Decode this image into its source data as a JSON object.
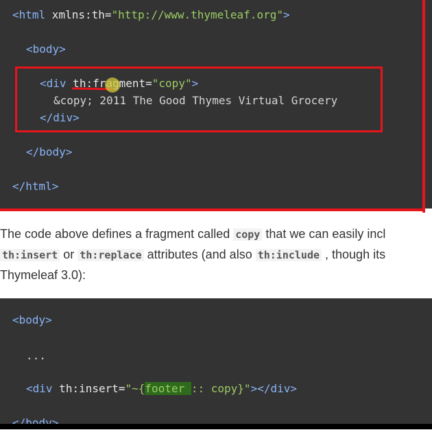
{
  "code_block_1": {
    "lines": [
      {
        "open": "<",
        "tag": "html",
        "attr": " xmlns:th",
        "eq": "=",
        "str": "\"http://www.thymeleaf.org\"",
        "close": ">"
      },
      {
        "text": "<body>"
      },
      {
        "open": "<",
        "tag": "div",
        "attr": " th:fragment",
        "eq": "=",
        "str": "\"copy\"",
        "close": ">"
      },
      {
        "text": "&copy; 2011 The Good Thymes Virtual Grocery"
      },
      {
        "text": "</div>"
      },
      {
        "text": "</body>"
      },
      {
        "text": "</html>"
      }
    ]
  },
  "paragraph": {
    "line1_pre": "The code above defines a fragment called ",
    "line1_code": "copy",
    "line1_post": " that we can easily incl",
    "line2_code1": "th:insert",
    "line2_mid1": " or ",
    "line2_code2": "th:replace",
    "line2_mid2": " attributes (and also ",
    "line2_code3": "th:include",
    "line2_post": " , though its",
    "line3": "Thymeleaf 3.0):"
  },
  "code_block_2": {
    "body_open": "<body>",
    "ellipsis": "...",
    "div_open": "<",
    "div_tag": "div",
    "div_attr": " th:insert",
    "div_eq": "=",
    "div_str_pre": "\"~{",
    "div_hl": "footer ",
    "div_str_post": ":: copy}\"",
    "div_close": "></div>",
    "body_close": "</body>"
  },
  "colors": {
    "code_bg": "#333333",
    "tag": "#8ab4f8",
    "string": "#9ccc65",
    "annotation_red": "#e8141b",
    "highlight": "#2e6b1c"
  }
}
